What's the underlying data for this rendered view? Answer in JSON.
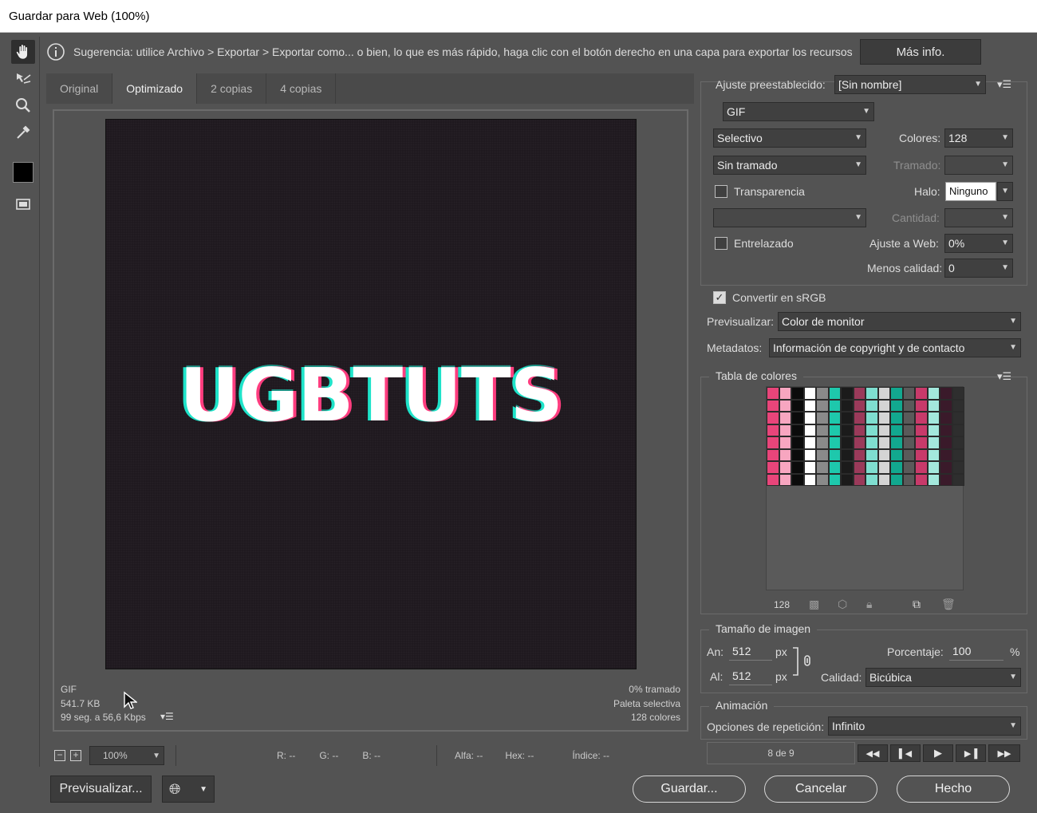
{
  "window": {
    "title": "Guardar para Web (100%)"
  },
  "hint": {
    "text": "Sugerencia: utilice Archivo > Exportar > Exportar como... o bien, lo que es más rápido, haga clic con el botón derecho en una capa para exportar los recursos",
    "more_info": "Más info."
  },
  "tabs": [
    {
      "label": "Original"
    },
    {
      "label": "Optimizado"
    },
    {
      "label": "2 copias"
    },
    {
      "label": "4 copias"
    }
  ],
  "canvas": {
    "text": "UGBTUTS"
  },
  "image_info": {
    "format": "GIF",
    "size": "541.7 KB",
    "speed": "99 seg. a 56,6 Kbps",
    "dither": "0% tramado",
    "palette": "Paleta selectiva",
    "colors": "128 colores"
  },
  "status": {
    "zoom": "100%",
    "r": "R: --",
    "g": "G: --",
    "b": "B: --",
    "alpha": "Alfa: --",
    "hex": "Hex: --",
    "index": "Índice: --"
  },
  "buttons": {
    "preview": "Previsualizar...",
    "save": "Guardar...",
    "cancel": "Cancelar",
    "done": "Hecho"
  },
  "settings": {
    "preset_label": "Ajuste preestablecido:",
    "preset": "[Sin nombre]",
    "format": "GIF",
    "reduction": "Selectivo",
    "colors_label": "Colores:",
    "colors": "128",
    "dither_algo": "Sin tramado",
    "dither_label": "Tramado:",
    "transparency": "Transparencia",
    "matte_label": "Halo:",
    "matte": "Ninguno",
    "amount_label": "Cantidad:",
    "interlaced": "Entrelazado",
    "websnap_label": "Ajuste a Web:",
    "websnap": "0%",
    "lossy_label": "Menos calidad:",
    "lossy": "0",
    "srgb": "Convertir en sRGB",
    "preview_label": "Previsualizar:",
    "preview": "Color de monitor",
    "metadata_label": "Metadatos:",
    "metadata": "Información de copyright y de contacto"
  },
  "color_table": {
    "title": "Tabla de colores",
    "count": "128"
  },
  "image_size": {
    "title": "Tamaño de imagen",
    "w_label": "An:",
    "w": "512",
    "h_label": "Al:",
    "h": "512",
    "unit": "px",
    "percent_label": "Porcentaje:",
    "percent": "100",
    "percent_unit": "%",
    "quality_label": "Calidad:",
    "quality": "Bicúbica"
  },
  "animation": {
    "title": "Animación",
    "loop_label": "Opciones de repetición:",
    "loop": "Infinito",
    "frame": "8 de 9"
  },
  "colors_theme": {
    "teal": "#1ec8ac",
    "pink": "#e8457a",
    "panel": "#535353"
  }
}
